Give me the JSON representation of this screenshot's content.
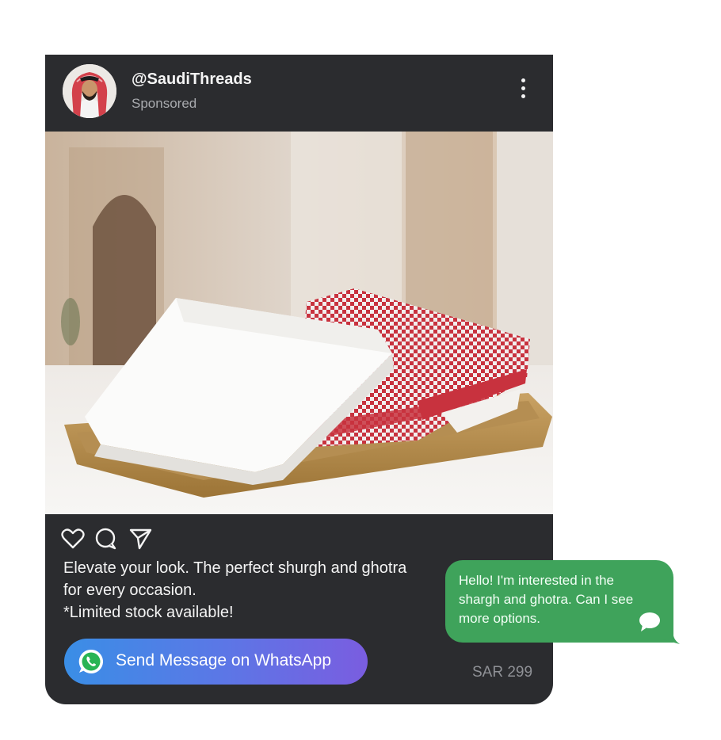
{
  "post": {
    "username": "@SaudiThreads",
    "sponsored": "Sponsored",
    "caption_lines": [
      "Elevate your look. The perfect shurgh and ghotra",
      "for every occasion.",
      "*Limited stock available!"
    ],
    "cta_label": "Send Message on WhatsApp",
    "price": "SAR 299",
    "actions": [
      "heart-icon",
      "comment-icon",
      "send-icon"
    ]
  },
  "chat_bubble": {
    "text": "Hello! I'm interested in the shargh and ghotra. Can I see more options."
  },
  "colors": {
    "card_bg": "#2b2c2f",
    "bubble_green": "#3fa35b",
    "cta_gradient_start": "#3a8ee6",
    "cta_gradient_end": "#7a5de0"
  }
}
